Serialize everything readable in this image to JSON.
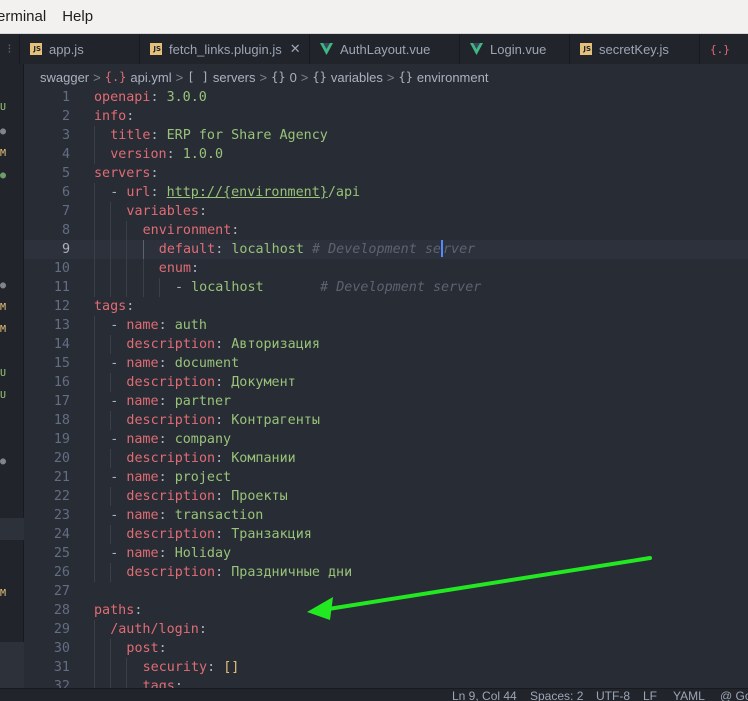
{
  "menubar": {
    "items": [
      "erminal",
      "Help"
    ]
  },
  "tabs": [
    {
      "label": "app.js",
      "icon": "js-file-icon",
      "badge": "JS"
    },
    {
      "label": "fetch_links.plugin.js",
      "icon": "js-file-icon",
      "badge": "JS",
      "close": "✕"
    },
    {
      "label": "AuthLayout.vue",
      "icon": "vue-file-icon"
    },
    {
      "label": "Login.vue",
      "icon": "vue-file-icon"
    },
    {
      "label": "secretKey.js",
      "icon": "js-file-icon",
      "badge": "JS"
    }
  ],
  "tab_edge_right": "{.}",
  "breadcrumb": {
    "items": [
      {
        "icon": "",
        "label": "swagger"
      },
      {
        "icon": "{.}",
        "label": "api.yml"
      },
      {
        "icon": "[ ]",
        "label": "servers"
      },
      {
        "icon": "{}",
        "label": "0"
      },
      {
        "icon": "{}",
        "label": "variables"
      },
      {
        "icon": "{}",
        "label": "environment"
      }
    ],
    "separator": ">"
  },
  "left_panel": {
    "markers": [
      {
        "text": "U",
        "kind": "U"
      },
      {
        "text": "●",
        "kind": "dot-grey"
      },
      {
        "text": "M",
        "kind": "M"
      },
      {
        "text": "●",
        "kind": "dot-green"
      },
      {
        "text": "●",
        "kind": "dot-grey"
      },
      {
        "text": "M",
        "kind": "M"
      },
      {
        "text": "M",
        "kind": "M"
      },
      {
        "text": "U",
        "kind": "U"
      },
      {
        "text": "U",
        "kind": "U"
      },
      {
        "text": "●",
        "kind": "dot-grey"
      },
      {
        "text": "M",
        "kind": "M"
      }
    ]
  },
  "editor": {
    "active_line": 9,
    "lines": [
      {
        "n": "1",
        "indent": 0,
        "tokens": [
          [
            "k",
            "openapi"
          ],
          [
            "p",
            ": "
          ],
          [
            "s",
            "3.0.0"
          ]
        ]
      },
      {
        "n": "2",
        "indent": 0,
        "tokens": [
          [
            "k",
            "info"
          ],
          [
            "p",
            ":"
          ]
        ]
      },
      {
        "n": "3",
        "indent": 1,
        "tokens": [
          [
            "k",
            "title"
          ],
          [
            "p",
            ": "
          ],
          [
            "s",
            "ERP for Share Agency"
          ]
        ]
      },
      {
        "n": "4",
        "indent": 1,
        "tokens": [
          [
            "k",
            "version"
          ],
          [
            "p",
            ": "
          ],
          [
            "s",
            "1.0.0"
          ]
        ]
      },
      {
        "n": "5",
        "indent": 0,
        "tokens": [
          [
            "k",
            "servers"
          ],
          [
            "p",
            ":"
          ]
        ]
      },
      {
        "n": "6",
        "indent": 1,
        "tokens": [
          [
            "p",
            "- "
          ],
          [
            "k",
            "url"
          ],
          [
            "p",
            ": "
          ],
          [
            "u",
            "http://{environment}"
          ],
          [
            "s",
            "/api"
          ]
        ]
      },
      {
        "n": "7",
        "indent": 2,
        "tokens": [
          [
            "k",
            "variables"
          ],
          [
            "p",
            ":"
          ]
        ]
      },
      {
        "n": "8",
        "indent": 3,
        "tokens": [
          [
            "k",
            "environment"
          ],
          [
            "p",
            ":"
          ]
        ]
      },
      {
        "n": "9",
        "indent": 4,
        "tokens": [
          [
            "k",
            "default"
          ],
          [
            "p",
            ": "
          ],
          [
            "s",
            "localhost"
          ],
          [
            "c",
            " # Development se"
          ],
          [
            "cur",
            ""
          ],
          [
            "c",
            "rver"
          ]
        ]
      },
      {
        "n": "10",
        "indent": 4,
        "tokens": [
          [
            "k",
            "enum"
          ],
          [
            "p",
            ":"
          ]
        ]
      },
      {
        "n": "11",
        "indent": 5,
        "tokens": [
          [
            "p",
            "- "
          ],
          [
            "s",
            "localhost"
          ],
          [
            "c",
            "       # Development server"
          ]
        ]
      },
      {
        "n": "12",
        "indent": 0,
        "tokens": [
          [
            "k",
            "tags"
          ],
          [
            "p",
            ":"
          ]
        ]
      },
      {
        "n": "13",
        "indent": 1,
        "tokens": [
          [
            "p",
            "- "
          ],
          [
            "k",
            "name"
          ],
          [
            "p",
            ": "
          ],
          [
            "s",
            "auth"
          ]
        ]
      },
      {
        "n": "14",
        "indent": 2,
        "tokens": [
          [
            "k",
            "description"
          ],
          [
            "p",
            ": "
          ],
          [
            "s",
            "Авторизация"
          ]
        ]
      },
      {
        "n": "15",
        "indent": 1,
        "tokens": [
          [
            "p",
            "- "
          ],
          [
            "k",
            "name"
          ],
          [
            "p",
            ": "
          ],
          [
            "s",
            "document"
          ]
        ]
      },
      {
        "n": "16",
        "indent": 2,
        "tokens": [
          [
            "k",
            "description"
          ],
          [
            "p",
            ": "
          ],
          [
            "s",
            "Документ"
          ]
        ]
      },
      {
        "n": "17",
        "indent": 1,
        "tokens": [
          [
            "p",
            "- "
          ],
          [
            "k",
            "name"
          ],
          [
            "p",
            ": "
          ],
          [
            "s",
            "partner"
          ]
        ]
      },
      {
        "n": "18",
        "indent": 2,
        "tokens": [
          [
            "k",
            "description"
          ],
          [
            "p",
            ": "
          ],
          [
            "s",
            "Контрагенты"
          ]
        ]
      },
      {
        "n": "19",
        "indent": 1,
        "tokens": [
          [
            "p",
            "- "
          ],
          [
            "k",
            "name"
          ],
          [
            "p",
            ": "
          ],
          [
            "s",
            "company"
          ]
        ]
      },
      {
        "n": "20",
        "indent": 2,
        "tokens": [
          [
            "k",
            "description"
          ],
          [
            "p",
            ": "
          ],
          [
            "s",
            "Компании"
          ]
        ]
      },
      {
        "n": "21",
        "indent": 1,
        "tokens": [
          [
            "p",
            "- "
          ],
          [
            "k",
            "name"
          ],
          [
            "p",
            ": "
          ],
          [
            "s",
            "project"
          ]
        ]
      },
      {
        "n": "22",
        "indent": 2,
        "tokens": [
          [
            "k",
            "description"
          ],
          [
            "p",
            ": "
          ],
          [
            "s",
            "Проекты"
          ]
        ]
      },
      {
        "n": "23",
        "indent": 1,
        "tokens": [
          [
            "p",
            "- "
          ],
          [
            "k",
            "name"
          ],
          [
            "p",
            ": "
          ],
          [
            "s",
            "transaction"
          ]
        ]
      },
      {
        "n": "24",
        "indent": 2,
        "tokens": [
          [
            "k",
            "description"
          ],
          [
            "p",
            ": "
          ],
          [
            "s",
            "Транзакция"
          ]
        ]
      },
      {
        "n": "25",
        "indent": 1,
        "tokens": [
          [
            "p",
            "- "
          ],
          [
            "k",
            "name"
          ],
          [
            "p",
            ": "
          ],
          [
            "s",
            "Holiday"
          ]
        ]
      },
      {
        "n": "26",
        "indent": 2,
        "tokens": [
          [
            "k",
            "description"
          ],
          [
            "p",
            ": "
          ],
          [
            "s",
            "Праздничные дни"
          ]
        ]
      },
      {
        "n": "27",
        "indent": 0,
        "tokens": []
      },
      {
        "n": "28",
        "indent": 0,
        "tokens": [
          [
            "k",
            "paths"
          ],
          [
            "p",
            ":"
          ]
        ]
      },
      {
        "n": "29",
        "indent": 1,
        "tokens": [
          [
            "k",
            "/auth/login"
          ],
          [
            "p",
            ":"
          ]
        ]
      },
      {
        "n": "30",
        "indent": 2,
        "tokens": [
          [
            "k",
            "post"
          ],
          [
            "p",
            ":"
          ]
        ]
      },
      {
        "n": "31",
        "indent": 3,
        "tokens": [
          [
            "k",
            "security"
          ],
          [
            "p",
            ": "
          ],
          [
            "b",
            "[]"
          ]
        ]
      },
      {
        "n": "32",
        "indent": 3,
        "tokens": [
          [
            "k",
            "tags"
          ],
          [
            "p",
            ":"
          ]
        ]
      }
    ]
  },
  "statusbar": {
    "position": "Ln 9, Col 44",
    "spaces": "Spaces: 2",
    "encoding": "UTF-8",
    "eol": "LF",
    "language": "YAML",
    "extra": "@ Go"
  },
  "colors": {
    "annotation_arrow": "#22e822"
  }
}
